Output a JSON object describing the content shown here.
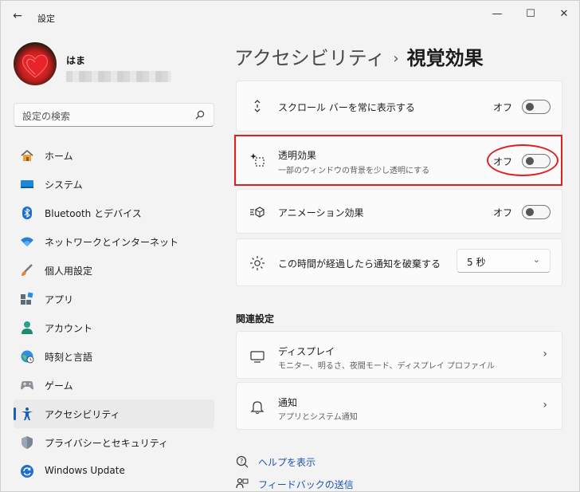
{
  "window": {
    "title": "設定",
    "back_glyph": "←",
    "min_glyph": "—",
    "max_glyph": "☐",
    "close_glyph": "✕"
  },
  "user": {
    "name": "はま",
    "email": ""
  },
  "search": {
    "placeholder": "設定の検索"
  },
  "sidebar": {
    "items": [
      {
        "label": "ホーム",
        "icon": "home-icon"
      },
      {
        "label": "システム",
        "icon": "system-icon"
      },
      {
        "label": "Bluetooth とデバイス",
        "icon": "bluetooth-icon"
      },
      {
        "label": "ネットワークとインターネット",
        "icon": "wifi-icon"
      },
      {
        "label": "個人用設定",
        "icon": "brush-icon"
      },
      {
        "label": "アプリ",
        "icon": "apps-icon"
      },
      {
        "label": "アカウント",
        "icon": "account-icon"
      },
      {
        "label": "時刻と言語",
        "icon": "globe-clock-icon"
      },
      {
        "label": "ゲーム",
        "icon": "gamepad-icon"
      },
      {
        "label": "アクセシビリティ",
        "icon": "accessibility-icon",
        "selected": true
      },
      {
        "label": "プライバシーとセキュリティ",
        "icon": "shield-icon"
      },
      {
        "label": "Windows Update",
        "icon": "windows-update-icon"
      }
    ]
  },
  "breadcrumb": {
    "parent": "アクセシビリティ",
    "separator": "›",
    "current": "視覚効果"
  },
  "settings": {
    "scrollbar": {
      "title": "スクロール バーを常に表示する",
      "state": "オフ"
    },
    "transparency": {
      "title": "透明効果",
      "subtitle": "一部のウィンドウの背景を少し透明にする",
      "state": "オフ"
    },
    "animation": {
      "title": "アニメーション効果",
      "state": "オフ"
    },
    "notification": {
      "title": "この時間が経過したら通知を破棄する",
      "value": "5 秒"
    }
  },
  "related": {
    "title": "関連設定",
    "display": {
      "title": "ディスプレイ",
      "subtitle": "モニター、明るさ、夜間モード、ディスプレイ プロファイル"
    },
    "notifications": {
      "title": "通知",
      "subtitle": "アプリとシステム通知"
    }
  },
  "links": {
    "help": "ヘルプを表示",
    "feedback": "フィードバックの送信"
  },
  "colors": {
    "accent": "#1a5fb4",
    "highlight": "#e02020",
    "link": "#1a56b0"
  }
}
